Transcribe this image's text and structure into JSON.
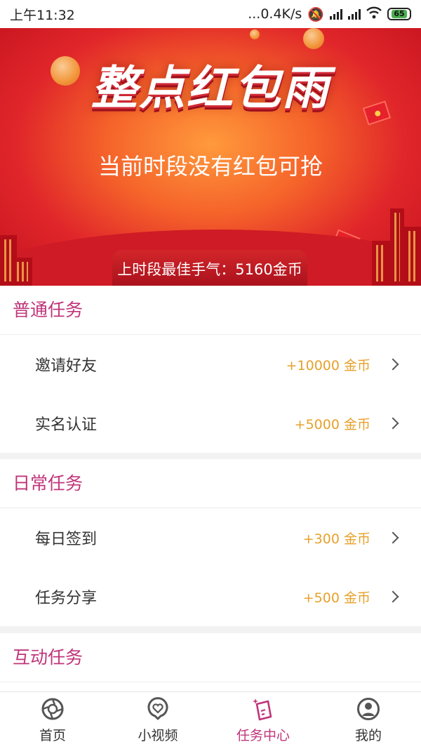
{
  "status_bar": {
    "time": "上午11:32",
    "network_speed": "...0.4K/s",
    "battery": "65"
  },
  "banner": {
    "title": "整点红包雨",
    "subtitle": "当前时段没有红包可抢",
    "best_luck": "上时段最佳手气：5160金币"
  },
  "sections": [
    {
      "title": "普通任务",
      "tasks": [
        {
          "name": "邀请好友",
          "reward": "+10000 金币"
        },
        {
          "name": "实名认证",
          "reward": "+5000 金币"
        }
      ]
    },
    {
      "title": "日常任务",
      "tasks": [
        {
          "name": "每日签到",
          "reward": "+300 金币"
        },
        {
          "name": "任务分享",
          "reward": "+500 金币"
        }
      ]
    },
    {
      "title": "互动任务",
      "tasks": []
    }
  ],
  "bottom_nav": {
    "items": [
      {
        "label": "首页",
        "icon": "home-icon"
      },
      {
        "label": "小视频",
        "icon": "video-heart-icon"
      },
      {
        "label": "任务中心",
        "icon": "task-center-icon"
      },
      {
        "label": "我的",
        "icon": "profile-icon"
      }
    ],
    "active": "任务中心"
  },
  "colors": {
    "accent": "#c0357a",
    "reward": "#e7a12b",
    "banner_red": "#e0262a"
  }
}
